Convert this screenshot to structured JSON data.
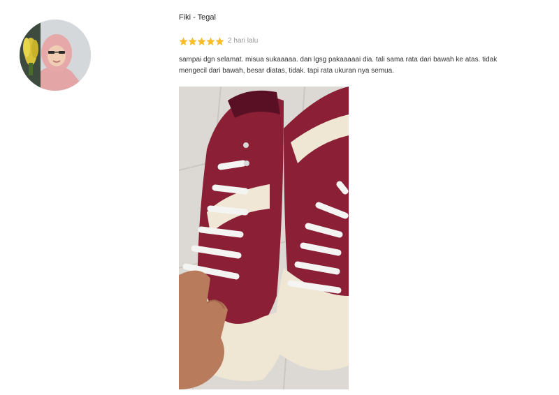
{
  "review": {
    "reviewer_name": "Fiki - Tegal",
    "rating": 5,
    "rating_max": 5,
    "time_ago": "2 hari lalu",
    "text": "sampai dgn selamat. misua sukaaaaa. dan lgsg pakaaaaai dia. tali sama rata dari bawah ke atas. tidak mengecil dari bawah, besar diatas, tidak. tapi rata ukuran nya semua.",
    "star_color": "#fbbf24",
    "photo_subject": "pair of maroon high-top canvas sneakers with white laces"
  },
  "icons": {
    "avatar": "user-avatar-photo",
    "star": "star-icon"
  }
}
